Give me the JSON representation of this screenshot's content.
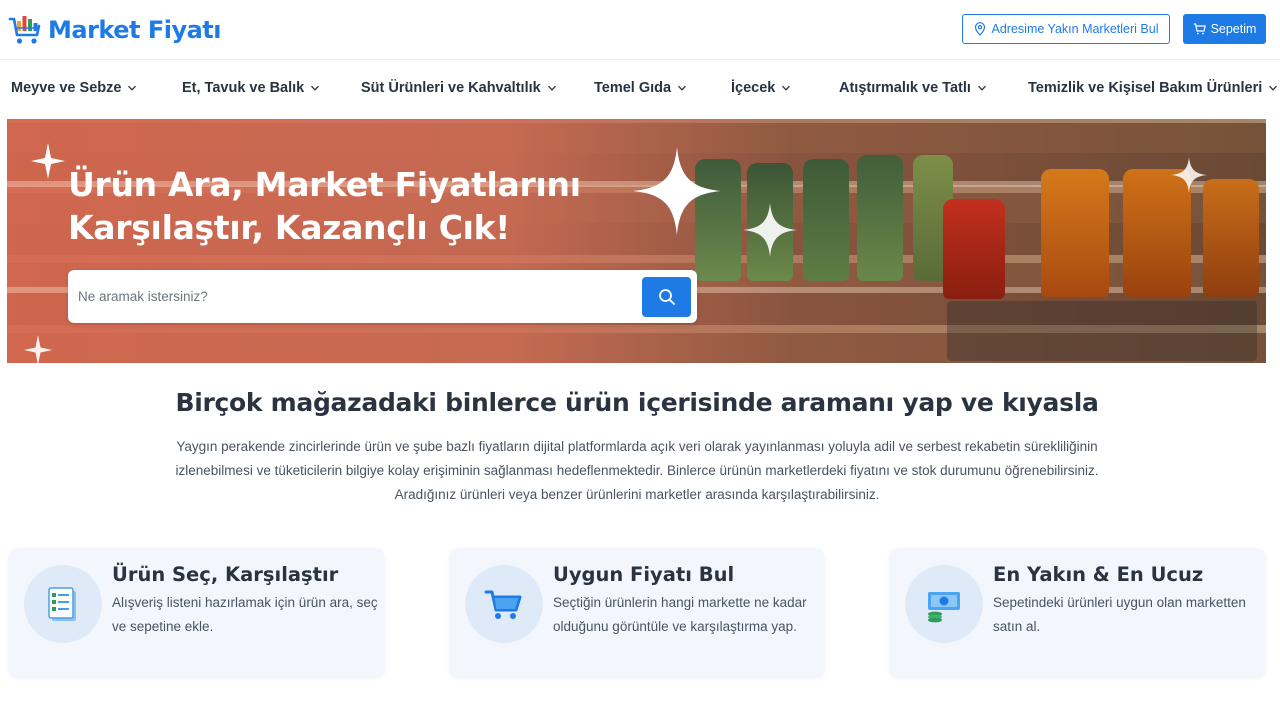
{
  "brand": {
    "name": "Market Fiyatı",
    "primary_color": "#1e7be6",
    "logo_icon": "cart-bars-logo-icon"
  },
  "header": {
    "address_button": {
      "label": "Adresime Yakın Marketleri Bul",
      "icon": "location-pin-icon"
    },
    "cart_button": {
      "label": "Sepetim",
      "icon": "cart-icon"
    }
  },
  "nav": {
    "items": [
      {
        "label": "Meyve ve Sebze"
      },
      {
        "label": "Et, Tavuk ve Balık"
      },
      {
        "label": "Süt Ürünleri ve Kahvaltılık"
      },
      {
        "label": "Temel Gıda"
      },
      {
        "label": "İçecek"
      },
      {
        "label": "Atıştırmalık ve Tatlı"
      },
      {
        "label": "Temizlik ve Kişisel Bakım Ürünleri"
      }
    ]
  },
  "hero": {
    "title_line1": "Ürün Ara, Market Fiyatlarını",
    "title_line2": "Karşılaştır, Kazançlı Çık!",
    "search": {
      "placeholder": "Ne aramak istersiniz?",
      "value": ""
    }
  },
  "intro": {
    "title": "Birçok mağazadaki binlerce ürün içerisinde aramanı yap ve kıyasla",
    "text": "Yaygın perakende zincirlerinde ürün ve şube bazlı fiyatların dijital platformlarda açık veri olarak yayınlanması yoluyla adil ve serbest rekabetin sürekliliğinin izlenebilmesi ve tüketicilerin bilgiye kolay erişiminin sağlanması hedeflenmektedir. Binlerce ürünün marketlerdeki fiyatını ve stok durumunu öğrenebilirsiniz. Aradığınız ürünleri veya benzer ürünlerini marketler arasında karşılaştırabilirsiniz."
  },
  "features": [
    {
      "title": "Ürün Seç, Karşılaştır",
      "text": "Alışveriş listeni hazırlamak için ürün ara, seç ve sepetine ekle.",
      "icon": "checklist-icon"
    },
    {
      "title": "Uygun Fiyatı Bul",
      "text": "Seçtiğin ürünlerin hangi markette ne kadar olduğunu görüntüle ve karşılaştırma yap.",
      "icon": "shopping-cart-icon"
    },
    {
      "title": "En Yakın & En Ucuz",
      "text": "Sepetindeki ürünleri uygun olan marketten satın al.",
      "icon": "money-icon"
    }
  ]
}
